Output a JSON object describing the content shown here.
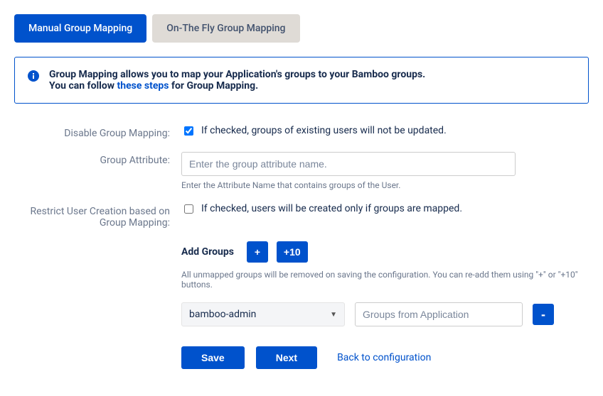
{
  "tabs": {
    "manual": "Manual Group Mapping",
    "onthefly": "On-The Fly Group Mapping"
  },
  "info": {
    "line1": "Group Mapping allows you to map your Application's groups to your Bamboo groups.",
    "line2_pre": "You can follow ",
    "line2_link": "these steps",
    "line2_post": " for Group Mapping."
  },
  "form": {
    "disable_label": "Disable Group Mapping:",
    "disable_text": "If checked, groups of existing users will not be updated.",
    "attr_label": "Group Attribute:",
    "attr_placeholder": "Enter the group attribute name.",
    "attr_help": "Enter the Attribute Name that contains groups of the User.",
    "restrict_label": "Restrict User Creation based on Group Mapping:",
    "restrict_text": "If checked, users will be created only if groups are mapped.",
    "add_groups_label": "Add Groups",
    "plus_label": "+",
    "plus10_label": "+10",
    "add_groups_help": "All unmapped groups will be removed on saving the configuration. You can re-add them using \"+\" or \"+10\" buttons.",
    "select_value": "bamboo-admin",
    "app_placeholder": "Groups from Application",
    "minus_label": "-"
  },
  "actions": {
    "save": "Save",
    "next": "Next",
    "back": "Back to configuration"
  }
}
